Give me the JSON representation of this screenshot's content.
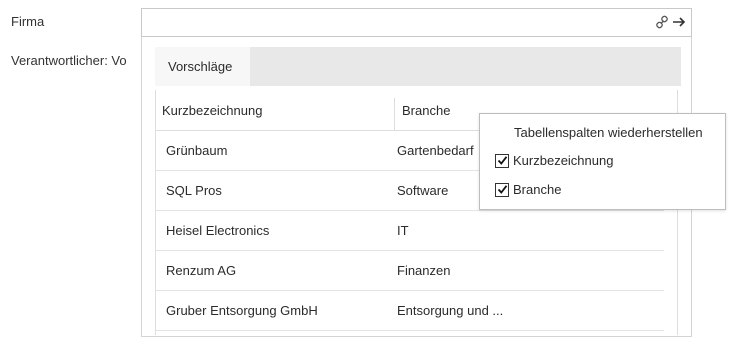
{
  "form": {
    "firma_label": "Firma",
    "verantwortlicher_label": "Verantwortlicher:  Vo",
    "firma_value": ""
  },
  "icons": {
    "link": "link-icon",
    "arrow": "arrow-right-icon",
    "check": "checkmark-icon"
  },
  "tabs": [
    {
      "label": "Vorschläge",
      "active": true
    }
  ],
  "table": {
    "columns": [
      "Kurzbezeichnung",
      "Branche"
    ],
    "rows": [
      {
        "kurzbezeichnung": "Grünbaum",
        "branche": "Gartenbedarf"
      },
      {
        "kurzbezeichnung": "SQL Pros",
        "branche": "Software"
      },
      {
        "kurzbezeichnung": "Heisel Electronics",
        "branche": "IT"
      },
      {
        "kurzbezeichnung": "Renzum AG",
        "branche": "Finanzen"
      },
      {
        "kurzbezeichnung": "Gruber Entsorgung GmbH",
        "branche": "Entsorgung und ..."
      }
    ]
  },
  "context_menu": {
    "restore_label": "Tabellenspalten wiederherstellen",
    "items": [
      {
        "label": "Kurzbezeichnung",
        "checked": true
      },
      {
        "label": "Branche",
        "checked": true
      }
    ]
  },
  "colors": {
    "border": "#c9c9c9",
    "tab_strip": "#e8e8e8",
    "scrollbar": "#cfcfcf"
  }
}
